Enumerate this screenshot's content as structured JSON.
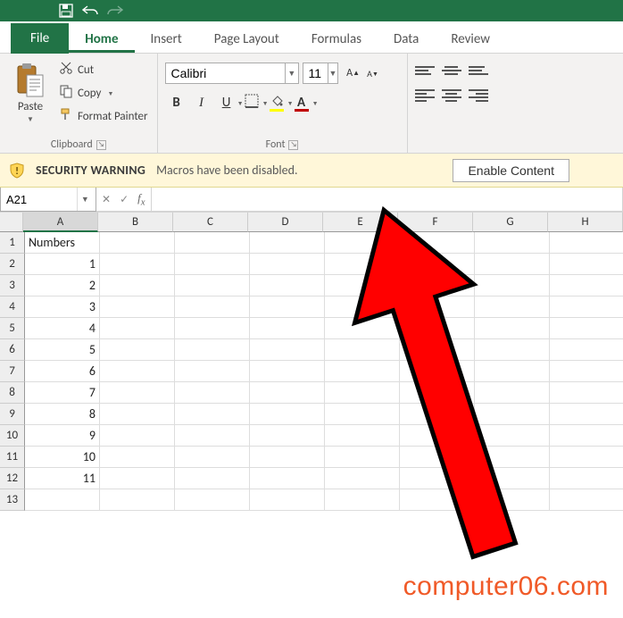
{
  "quick_access": {
    "save_tooltip": "Save"
  },
  "tabs": {
    "file": "File",
    "home": "Home",
    "insert": "Insert",
    "page_layout": "Page Layout",
    "formulas": "Formulas",
    "data": "Data",
    "review": "Review"
  },
  "clipboard": {
    "paste": "Paste",
    "cut": "Cut",
    "copy": "Copy",
    "format_painter": "Format Painter",
    "group_label": "Clipboard"
  },
  "font": {
    "name_value": "Calibri",
    "size_value": "11",
    "bold": "B",
    "italic": "I",
    "underline": "U",
    "font_color": "#c00000",
    "fill_color": "#ffff00",
    "group_label": "Font"
  },
  "security": {
    "title": "SECURITY WARNING",
    "message": "Macros have been disabled.",
    "enable": "Enable Content"
  },
  "formula_bar": {
    "name_box": "A21",
    "value": ""
  },
  "grid": {
    "columns": [
      "A",
      "B",
      "C",
      "D",
      "E",
      "F",
      "G",
      "H"
    ],
    "header_cell": "Numbers",
    "data_col_values": [
      "1",
      "2",
      "3",
      "4",
      "5",
      "6",
      "7",
      "8",
      "9",
      "10",
      "11"
    ],
    "row_count": 13
  },
  "watermark": "computer06.com",
  "chart_data": {
    "type": "table",
    "title": "Numbers",
    "categories": [
      "1",
      "2",
      "3",
      "4",
      "5",
      "6",
      "7",
      "8",
      "9",
      "10",
      "11"
    ],
    "values": [
      1,
      2,
      3,
      4,
      5,
      6,
      7,
      8,
      9,
      10,
      11
    ]
  }
}
